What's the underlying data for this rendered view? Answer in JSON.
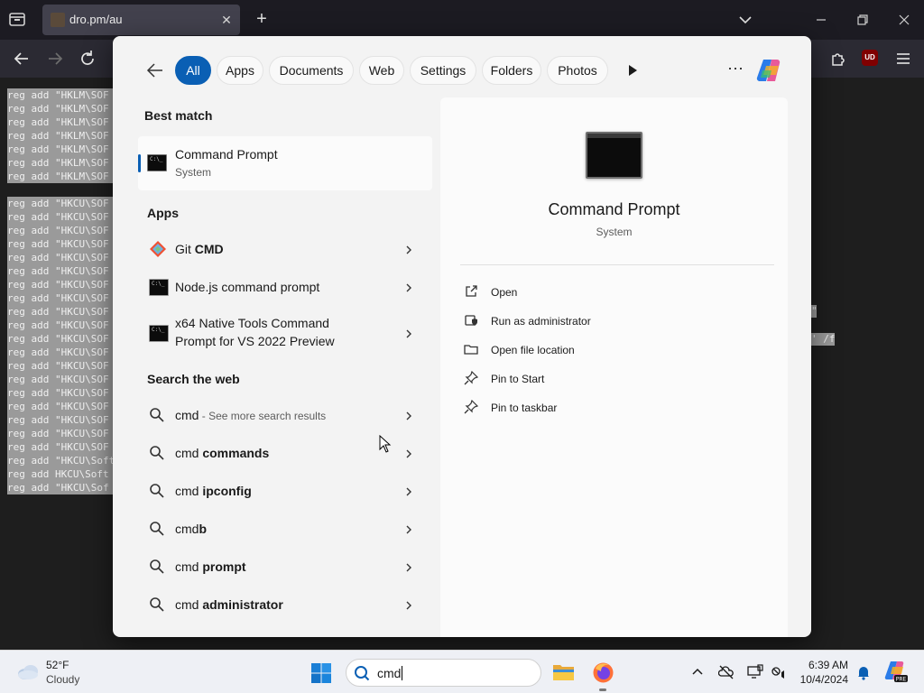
{
  "browser": {
    "tab_title": "dro.pm/au",
    "new_tab_glyph": "+",
    "close_glyph": "✕",
    "ublock_label": "UD"
  },
  "page_content": {
    "block1": [
      "reg add \"HKLM\\SOF",
      "reg add \"HKLM\\SOF",
      "reg add \"HKLM\\SOF",
      "reg add \"HKLM\\SOF",
      "reg add \"HKLM\\SOF",
      "reg add \"HKLM\\SOF",
      "reg add \"HKLM\\SOF"
    ],
    "block2": [
      "reg add \"HKCU\\SOF",
      "reg add \"HKCU\\SOF",
      "reg add \"HKCU\\SOF",
      "reg add \"HKCU\\SOF",
      "reg add \"HKCU\\SOF",
      "reg add \"HKCU\\SOF",
      "reg add \"HKCU\\SOF",
      "reg add \"HKCU\\SOF",
      "reg add \"HKCU\\SOF",
      "reg add \"HKCU\\SOF",
      "reg add \"HKCU\\SOF",
      "reg add \"HKCU\\SOF",
      "reg add \"HKCU\\SOF",
      "reg add \"HKCU\\SOF",
      "reg add \"HKCU\\SOF",
      "reg add \"HKCU\\SOF",
      "reg add \"HKCU\\SOF",
      "reg add \"HKCU\\SOF",
      "reg add \"HKCU\\SOF",
      "reg add \"HKCU\\Soft",
      "reg add HKCU\\Soft",
      "reg add \"HKCU\\Sof"
    ],
    "frag1": "\"",
    "frag2": "' /f"
  },
  "search": {
    "filters": [
      "All",
      "Apps",
      "Documents",
      "Web",
      "Settings",
      "Folders",
      "Photos"
    ],
    "more_glyph": "···",
    "best_match_heading": "Best match",
    "best_match": {
      "title": "Command Prompt",
      "subtitle": "System"
    },
    "apps_heading": "Apps",
    "apps": [
      {
        "pre": "Git ",
        "bold": "CMD"
      },
      {
        "pre": "Node.js command prompt",
        "bold": ""
      },
      {
        "line1": "x64 Native Tools Command",
        "line2": "Prompt for VS 2022 Preview"
      }
    ],
    "web_heading": "Search the web",
    "web": [
      {
        "pre": "cmd",
        "bold": "",
        "suffix": " - See more search results"
      },
      {
        "pre": "cmd ",
        "bold": "commands",
        "suffix": ""
      },
      {
        "pre": "cmd ",
        "bold": "ipconfig",
        "suffix": ""
      },
      {
        "pre": "cmd",
        "bold": "b",
        "suffix": ""
      },
      {
        "pre": "cmd ",
        "bold": "prompt",
        "suffix": ""
      },
      {
        "pre": "cmd ",
        "bold": "administrator",
        "suffix": ""
      }
    ],
    "preview": {
      "title": "Command Prompt",
      "subtitle": "System",
      "actions": [
        "Open",
        "Run as administrator",
        "Open file location",
        "Pin to Start",
        "Pin to taskbar"
      ]
    }
  },
  "taskbar": {
    "weather_temp": "52°F",
    "weather_cond": "Cloudy",
    "search_text": "cmd",
    "time": "6:39 AM",
    "date": "10/4/2024",
    "copilot_badge": "PRE"
  }
}
